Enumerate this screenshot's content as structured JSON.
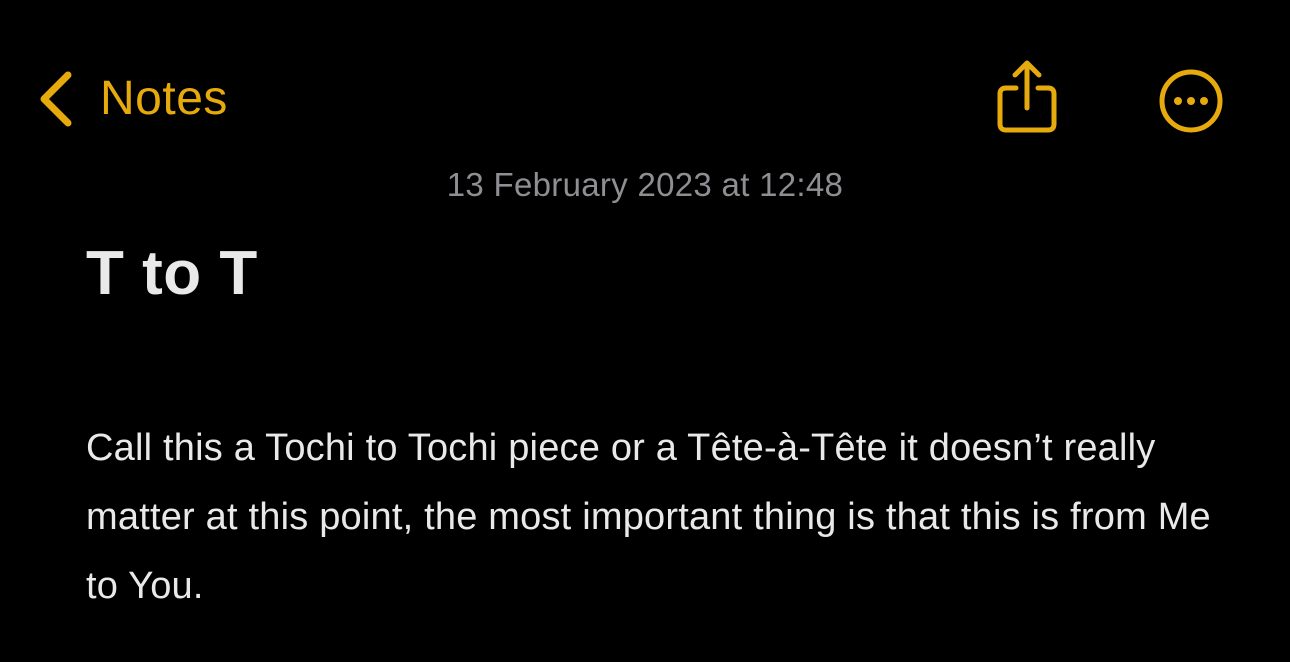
{
  "nav": {
    "back_label": "Notes"
  },
  "icons": {
    "back": "chevron-left-icon",
    "share": "share-icon",
    "more": "ellipsis-circle-icon"
  },
  "colors": {
    "accent": "#e7aa0c",
    "background": "#000000",
    "text": "#e9e9e9",
    "secondary_text": "#8e8e93"
  },
  "note": {
    "timestamp": "13 February 2023 at 12:48",
    "title": "T to T",
    "body": "Call this a Tochi to Tochi piece or a Tête-à-Tête it doesn’t really matter at this point, the most important thing is that this is from Me to You."
  }
}
